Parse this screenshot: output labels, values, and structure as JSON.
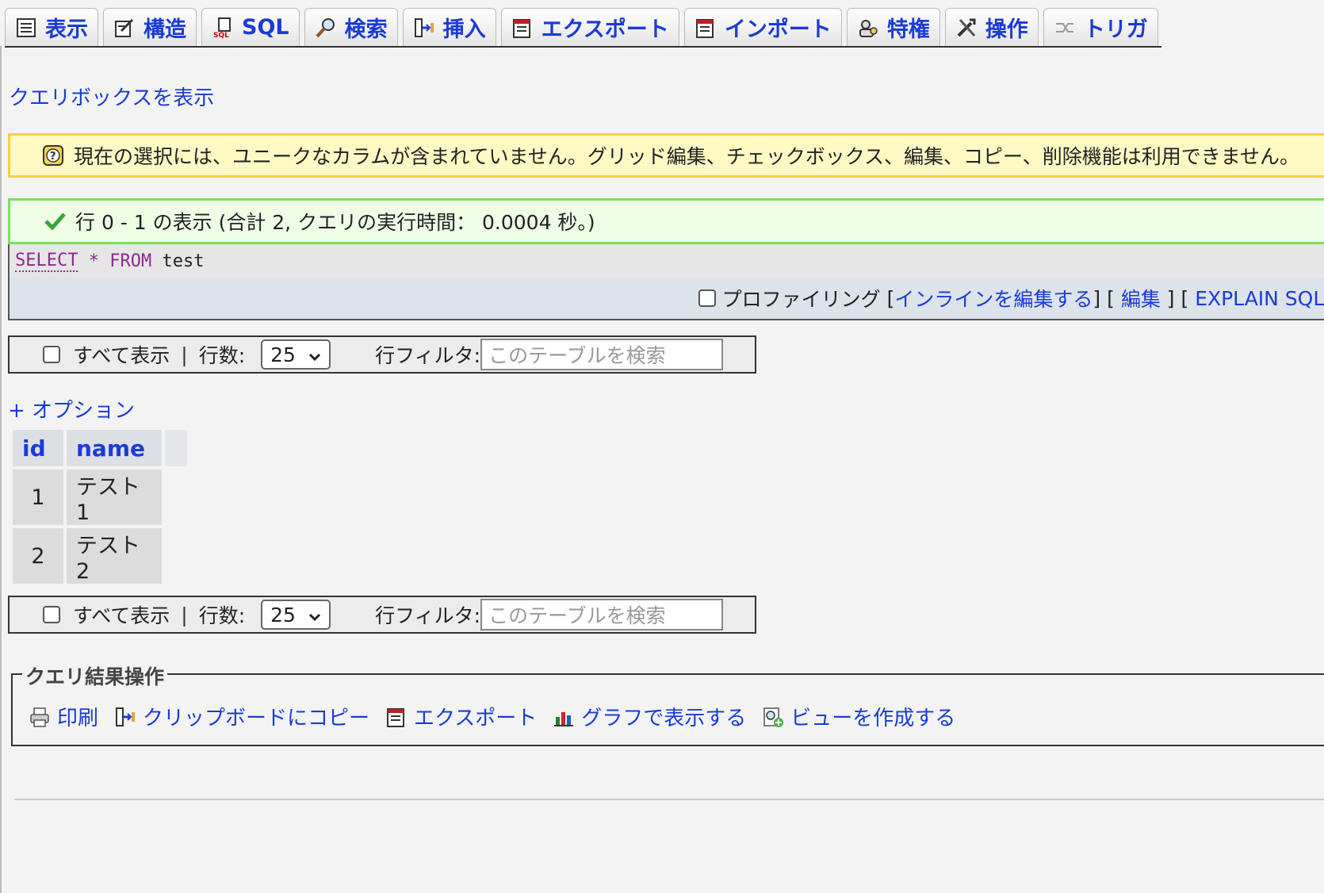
{
  "tabs": [
    {
      "label": "表示",
      "icon": "table-browse-icon"
    },
    {
      "label": "構造",
      "icon": "structure-icon"
    },
    {
      "label": "SQL",
      "icon": "sql-icon"
    },
    {
      "label": "検索",
      "icon": "search-icon"
    },
    {
      "label": "挿入",
      "icon": "insert-icon"
    },
    {
      "label": "エクスポート",
      "icon": "export-icon"
    },
    {
      "label": "インポート",
      "icon": "import-icon"
    },
    {
      "label": "特権",
      "icon": "privileges-icon"
    },
    {
      "label": "操作",
      "icon": "operations-icon"
    },
    {
      "label": "トリガ",
      "icon": "triggers-icon"
    }
  ],
  "query_box_link": "クエリボックスを表示",
  "notice": {
    "icon": "question-icon",
    "text": "現在の選択には、ユニークなカラムが含まれていません。グリッド編集、チェックボックス、編集、コピー、削除機能は利用できません。"
  },
  "success": {
    "icon": "checkmark-icon",
    "text": "行 0 - 1 の表示 (合計 2, クエリの実行時間： 0.0004 秒。)"
  },
  "sql": {
    "select": "SELECT",
    "star": "*",
    "from": "FROM",
    "table": "test"
  },
  "sql_tools": {
    "profiling": "プロファイリング",
    "inline_edit": "インラインを編集する",
    "edit": "編集",
    "explain": "EXPLAIN SQL"
  },
  "navbar": {
    "show_all": "すべて表示",
    "separator": "|",
    "rows_label": "行数:",
    "rows_value": "25",
    "filter_label": "行フィルタ:",
    "filter_placeholder": "このテーブルを検索"
  },
  "options_link": "+ オプション",
  "table": {
    "columns": [
      "id",
      "name"
    ],
    "rows": [
      [
        "1",
        "テスト1"
      ],
      [
        "2",
        "テスト2"
      ]
    ]
  },
  "query_ops": {
    "legend": "クエリ結果操作",
    "items": [
      {
        "label": "印刷",
        "icon": "print-icon"
      },
      {
        "label": "クリップボードにコピー",
        "icon": "clipboard-icon"
      },
      {
        "label": "エクスポート",
        "icon": "export-icon"
      },
      {
        "label": "グラフで表示する",
        "icon": "chart-icon"
      },
      {
        "label": "ビューを作成する",
        "icon": "create-view-icon"
      }
    ]
  }
}
